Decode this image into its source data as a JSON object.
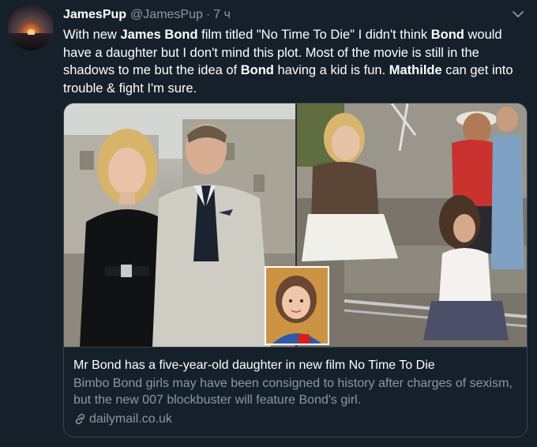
{
  "tweet": {
    "display_name": "JamesPup",
    "handle": "@JamesPup",
    "separator": "·",
    "time": "7 ч",
    "text_segments": [
      {
        "text": "With new ",
        "bold": false
      },
      {
        "text": "James Bond",
        "bold": true
      },
      {
        "text": " film titled \"No Time To Die\" I didn't think ",
        "bold": false
      },
      {
        "text": "Bond",
        "bold": true
      },
      {
        "text": " would have a daughter but I don't mind this plot. Most of the movie is still in the shadows to me but the idea of ",
        "bold": false
      },
      {
        "text": "Bond",
        "bold": true
      },
      {
        "text": " having a kid is fun. ",
        "bold": false
      },
      {
        "text": "Mathilde",
        "bold": true
      },
      {
        "text": " can get into trouble & fight I'm sure.",
        "bold": false
      }
    ]
  },
  "card": {
    "title": "Mr Bond has a five-year-old daughter in new film No Time To Die",
    "description": "Bimbo Bond girls may have been consigned to history after charges of sexism, but the new 007 blockbuster will feature Bond's girl.",
    "domain": "dailymail.co.uk",
    "link_icon": "link-icon"
  },
  "colors": {
    "background": "#15202b",
    "text": "#ffffff",
    "secondary_text": "#8899a6",
    "border": "#38444d"
  }
}
